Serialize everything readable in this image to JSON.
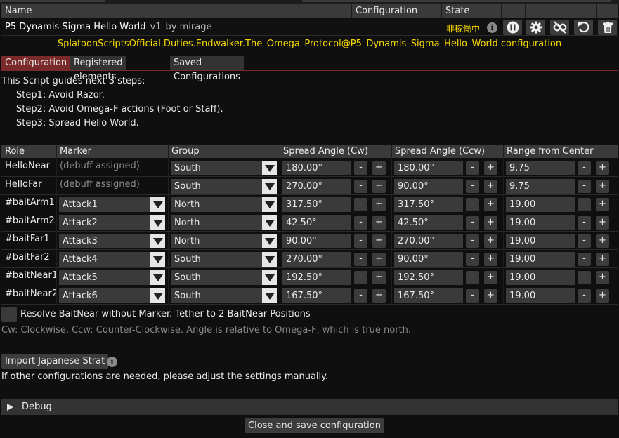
{
  "header": {
    "col_name": "Name",
    "col_configuration": "Configuration",
    "col_state": "State"
  },
  "script": {
    "name": "P5 Dynamis Sigma Hello World",
    "version": "v1",
    "author": "by mirage",
    "state": "非稼働中",
    "info_glyph": "i",
    "buttons": [
      "pause-icon",
      "gear-icon",
      "unlink-icon",
      "reload-icon",
      "trash-icon"
    ]
  },
  "config_title": "SplatoonScriptsOfficial.Duties.Endwalker.The_Omega_Protocol@P5_Dynamis_Sigma_Hello_World configuration",
  "tabs": [
    "Configuration",
    "Registered elements",
    "Saved Configurations"
  ],
  "description": {
    "intro": "This Script guides next 3 steps:",
    "step1": "Step1: Avoid Razor.",
    "step2": "Step2: Avoid Omega-F actions (Foot or Staff).",
    "step3": "Step3: Spread Hello World."
  },
  "table": {
    "headers": [
      "Role",
      "Marker",
      "Group",
      "Spread Angle (Cw)",
      "Spread Angle (Ccw)",
      "Range from Center"
    ],
    "minus": "-",
    "plus": "+",
    "rows": [
      {
        "role": "HelloNear",
        "marker": "(debuff assigned)",
        "group": "South",
        "cw": "180.00°",
        "ccw": "180.00°",
        "range": "9.75"
      },
      {
        "role": "HelloFar",
        "marker": "(debuff assigned)",
        "group": "South",
        "cw": "270.00°",
        "ccw": "90.00°",
        "range": "9.75"
      },
      {
        "role": "#baitArm1",
        "marker": "Attack1",
        "group": "North",
        "cw": "317.50°",
        "ccw": "317.50°",
        "range": "19.00"
      },
      {
        "role": "#baitArm2",
        "marker": "Attack2",
        "group": "North",
        "cw": "42.50°",
        "ccw": "42.50°",
        "range": "19.00"
      },
      {
        "role": "#baitFar1",
        "marker": "Attack3",
        "group": "North",
        "cw": "90.00°",
        "ccw": "270.00°",
        "range": "19.00"
      },
      {
        "role": "#baitFar2",
        "marker": "Attack4",
        "group": "South",
        "cw": "270.00°",
        "ccw": "90.00°",
        "range": "19.00"
      },
      {
        "role": "#baitNear1",
        "marker": "Attack5",
        "group": "South",
        "cw": "192.50°",
        "ccw": "192.50°",
        "range": "19.00"
      },
      {
        "role": "#baitNear2",
        "marker": "Attack6",
        "group": "South",
        "cw": "167.50°",
        "ccw": "167.50°",
        "range": "19.00"
      }
    ]
  },
  "resolve_label": "Resolve BaitNear without Marker. Tether to 2 BaitNear Positions",
  "note": "Cw: Clockwise, Ccw: Counter-Clockwise. Angle is relative to Omega-F, which is true north.",
  "import_button": "Import Japanese Strat",
  "adjust_text": "If other configurations are needed, please adjust the settings manually.",
  "debug_label": "Debug",
  "close_button": "Close and save configuration"
}
